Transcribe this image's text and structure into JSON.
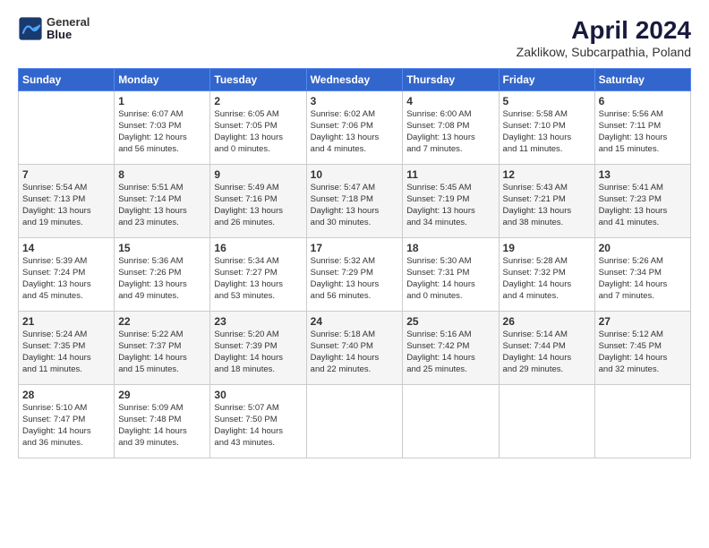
{
  "header": {
    "logo_line1": "General",
    "logo_line2": "Blue",
    "title": "April 2024",
    "subtitle": "Zaklikow, Subcarpathia, Poland"
  },
  "days_of_week": [
    "Sunday",
    "Monday",
    "Tuesday",
    "Wednesday",
    "Thursday",
    "Friday",
    "Saturday"
  ],
  "weeks": [
    [
      {
        "num": "",
        "info": ""
      },
      {
        "num": "1",
        "info": "Sunrise: 6:07 AM\nSunset: 7:03 PM\nDaylight: 12 hours\nand 56 minutes."
      },
      {
        "num": "2",
        "info": "Sunrise: 6:05 AM\nSunset: 7:05 PM\nDaylight: 13 hours\nand 0 minutes."
      },
      {
        "num": "3",
        "info": "Sunrise: 6:02 AM\nSunset: 7:06 PM\nDaylight: 13 hours\nand 4 minutes."
      },
      {
        "num": "4",
        "info": "Sunrise: 6:00 AM\nSunset: 7:08 PM\nDaylight: 13 hours\nand 7 minutes."
      },
      {
        "num": "5",
        "info": "Sunrise: 5:58 AM\nSunset: 7:10 PM\nDaylight: 13 hours\nand 11 minutes."
      },
      {
        "num": "6",
        "info": "Sunrise: 5:56 AM\nSunset: 7:11 PM\nDaylight: 13 hours\nand 15 minutes."
      }
    ],
    [
      {
        "num": "7",
        "info": "Sunrise: 5:54 AM\nSunset: 7:13 PM\nDaylight: 13 hours\nand 19 minutes."
      },
      {
        "num": "8",
        "info": "Sunrise: 5:51 AM\nSunset: 7:14 PM\nDaylight: 13 hours\nand 23 minutes."
      },
      {
        "num": "9",
        "info": "Sunrise: 5:49 AM\nSunset: 7:16 PM\nDaylight: 13 hours\nand 26 minutes."
      },
      {
        "num": "10",
        "info": "Sunrise: 5:47 AM\nSunset: 7:18 PM\nDaylight: 13 hours\nand 30 minutes."
      },
      {
        "num": "11",
        "info": "Sunrise: 5:45 AM\nSunset: 7:19 PM\nDaylight: 13 hours\nand 34 minutes."
      },
      {
        "num": "12",
        "info": "Sunrise: 5:43 AM\nSunset: 7:21 PM\nDaylight: 13 hours\nand 38 minutes."
      },
      {
        "num": "13",
        "info": "Sunrise: 5:41 AM\nSunset: 7:23 PM\nDaylight: 13 hours\nand 41 minutes."
      }
    ],
    [
      {
        "num": "14",
        "info": "Sunrise: 5:39 AM\nSunset: 7:24 PM\nDaylight: 13 hours\nand 45 minutes."
      },
      {
        "num": "15",
        "info": "Sunrise: 5:36 AM\nSunset: 7:26 PM\nDaylight: 13 hours\nand 49 minutes."
      },
      {
        "num": "16",
        "info": "Sunrise: 5:34 AM\nSunset: 7:27 PM\nDaylight: 13 hours\nand 53 minutes."
      },
      {
        "num": "17",
        "info": "Sunrise: 5:32 AM\nSunset: 7:29 PM\nDaylight: 13 hours\nand 56 minutes."
      },
      {
        "num": "18",
        "info": "Sunrise: 5:30 AM\nSunset: 7:31 PM\nDaylight: 14 hours\nand 0 minutes."
      },
      {
        "num": "19",
        "info": "Sunrise: 5:28 AM\nSunset: 7:32 PM\nDaylight: 14 hours\nand 4 minutes."
      },
      {
        "num": "20",
        "info": "Sunrise: 5:26 AM\nSunset: 7:34 PM\nDaylight: 14 hours\nand 7 minutes."
      }
    ],
    [
      {
        "num": "21",
        "info": "Sunrise: 5:24 AM\nSunset: 7:35 PM\nDaylight: 14 hours\nand 11 minutes."
      },
      {
        "num": "22",
        "info": "Sunrise: 5:22 AM\nSunset: 7:37 PM\nDaylight: 14 hours\nand 15 minutes."
      },
      {
        "num": "23",
        "info": "Sunrise: 5:20 AM\nSunset: 7:39 PM\nDaylight: 14 hours\nand 18 minutes."
      },
      {
        "num": "24",
        "info": "Sunrise: 5:18 AM\nSunset: 7:40 PM\nDaylight: 14 hours\nand 22 minutes."
      },
      {
        "num": "25",
        "info": "Sunrise: 5:16 AM\nSunset: 7:42 PM\nDaylight: 14 hours\nand 25 minutes."
      },
      {
        "num": "26",
        "info": "Sunrise: 5:14 AM\nSunset: 7:44 PM\nDaylight: 14 hours\nand 29 minutes."
      },
      {
        "num": "27",
        "info": "Sunrise: 5:12 AM\nSunset: 7:45 PM\nDaylight: 14 hours\nand 32 minutes."
      }
    ],
    [
      {
        "num": "28",
        "info": "Sunrise: 5:10 AM\nSunset: 7:47 PM\nDaylight: 14 hours\nand 36 minutes."
      },
      {
        "num": "29",
        "info": "Sunrise: 5:09 AM\nSunset: 7:48 PM\nDaylight: 14 hours\nand 39 minutes."
      },
      {
        "num": "30",
        "info": "Sunrise: 5:07 AM\nSunset: 7:50 PM\nDaylight: 14 hours\nand 43 minutes."
      },
      {
        "num": "",
        "info": ""
      },
      {
        "num": "",
        "info": ""
      },
      {
        "num": "",
        "info": ""
      },
      {
        "num": "",
        "info": ""
      }
    ]
  ]
}
